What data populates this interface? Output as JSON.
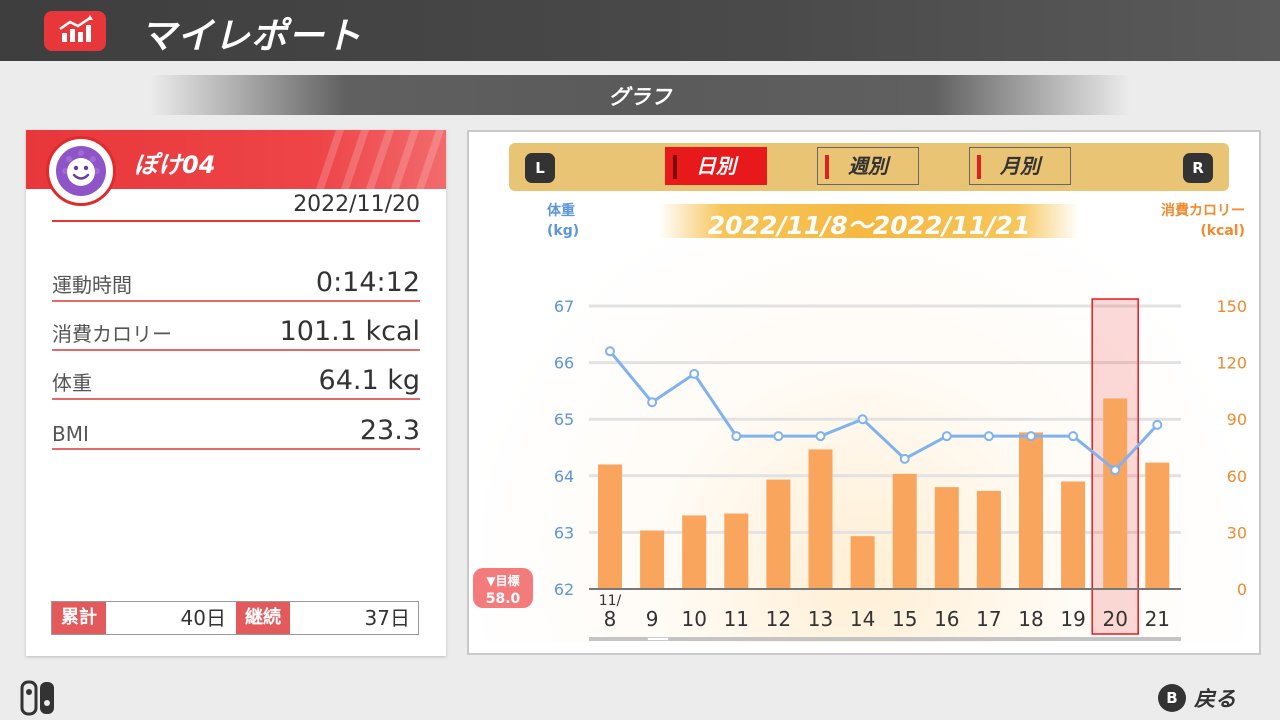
{
  "app": {
    "title": "マイレポート",
    "icon": "chart-icon"
  },
  "subheader": {
    "title": "グラフ"
  },
  "profile": {
    "name": "ぽけ04",
    "date": "2022/11/20",
    "stats": [
      {
        "label": "運動時間",
        "value": "0:14:12"
      },
      {
        "label": "消費カロリー",
        "value": "101.1 kcal"
      },
      {
        "label": "体重",
        "value": "64.1 kg"
      },
      {
        "label": "BMI",
        "value": "23.3"
      }
    ],
    "totals": {
      "total_label": "累計",
      "total_value": "40日",
      "streak_label": "継続",
      "streak_value": "37日"
    }
  },
  "graph": {
    "left_button": "L",
    "right_button": "R",
    "tabs": [
      {
        "label": "日別",
        "active": true
      },
      {
        "label": "週別",
        "active": false
      },
      {
        "label": "月別",
        "active": false
      }
    ],
    "range": "2022/11/8～2022/11/21",
    "left_axis_title_1": "体重",
    "left_axis_title_2": "(kg)",
    "right_axis_title_1": "消費カロリー",
    "right_axis_title_2": "(kcal)",
    "goal_label": "▼目標",
    "goal_value": "58.0",
    "month_label": "11/"
  },
  "chart_data": {
    "type": "bar+line",
    "categories": [
      "8",
      "9",
      "10",
      "11",
      "12",
      "13",
      "14",
      "15",
      "16",
      "17",
      "18",
      "19",
      "20",
      "21"
    ],
    "series": [
      {
        "name": "消費カロリー",
        "axis": "right",
        "type": "bar",
        "values": [
          66,
          31,
          39,
          40,
          58,
          74,
          28,
          61,
          54,
          52,
          83,
          57,
          101,
          67
        ]
      },
      {
        "name": "体重",
        "axis": "left",
        "type": "line",
        "values": [
          66.2,
          65.3,
          65.8,
          64.7,
          64.7,
          64.7,
          65.0,
          64.3,
          64.7,
          64.7,
          64.7,
          64.7,
          64.1,
          64.9
        ]
      }
    ],
    "left_axis": {
      "ticks": [
        "62",
        "63",
        "64",
        "65",
        "66",
        "67"
      ],
      "ylim": [
        62,
        67
      ]
    },
    "right_axis": {
      "ticks": [
        "0",
        "30",
        "60",
        "90",
        "120",
        "150"
      ],
      "ylim": [
        0,
        150
      ]
    },
    "highlight_category": "20",
    "colors": {
      "bar": "#f9a55e",
      "line": "#7fb2ee",
      "highlight": "#e8191b",
      "left_axis": "#5b95dc",
      "right_axis": "#f08a2e"
    }
  },
  "footer": {
    "back_button": "B",
    "back_label": "戻る",
    "controller_icon": "joycon-icon"
  }
}
